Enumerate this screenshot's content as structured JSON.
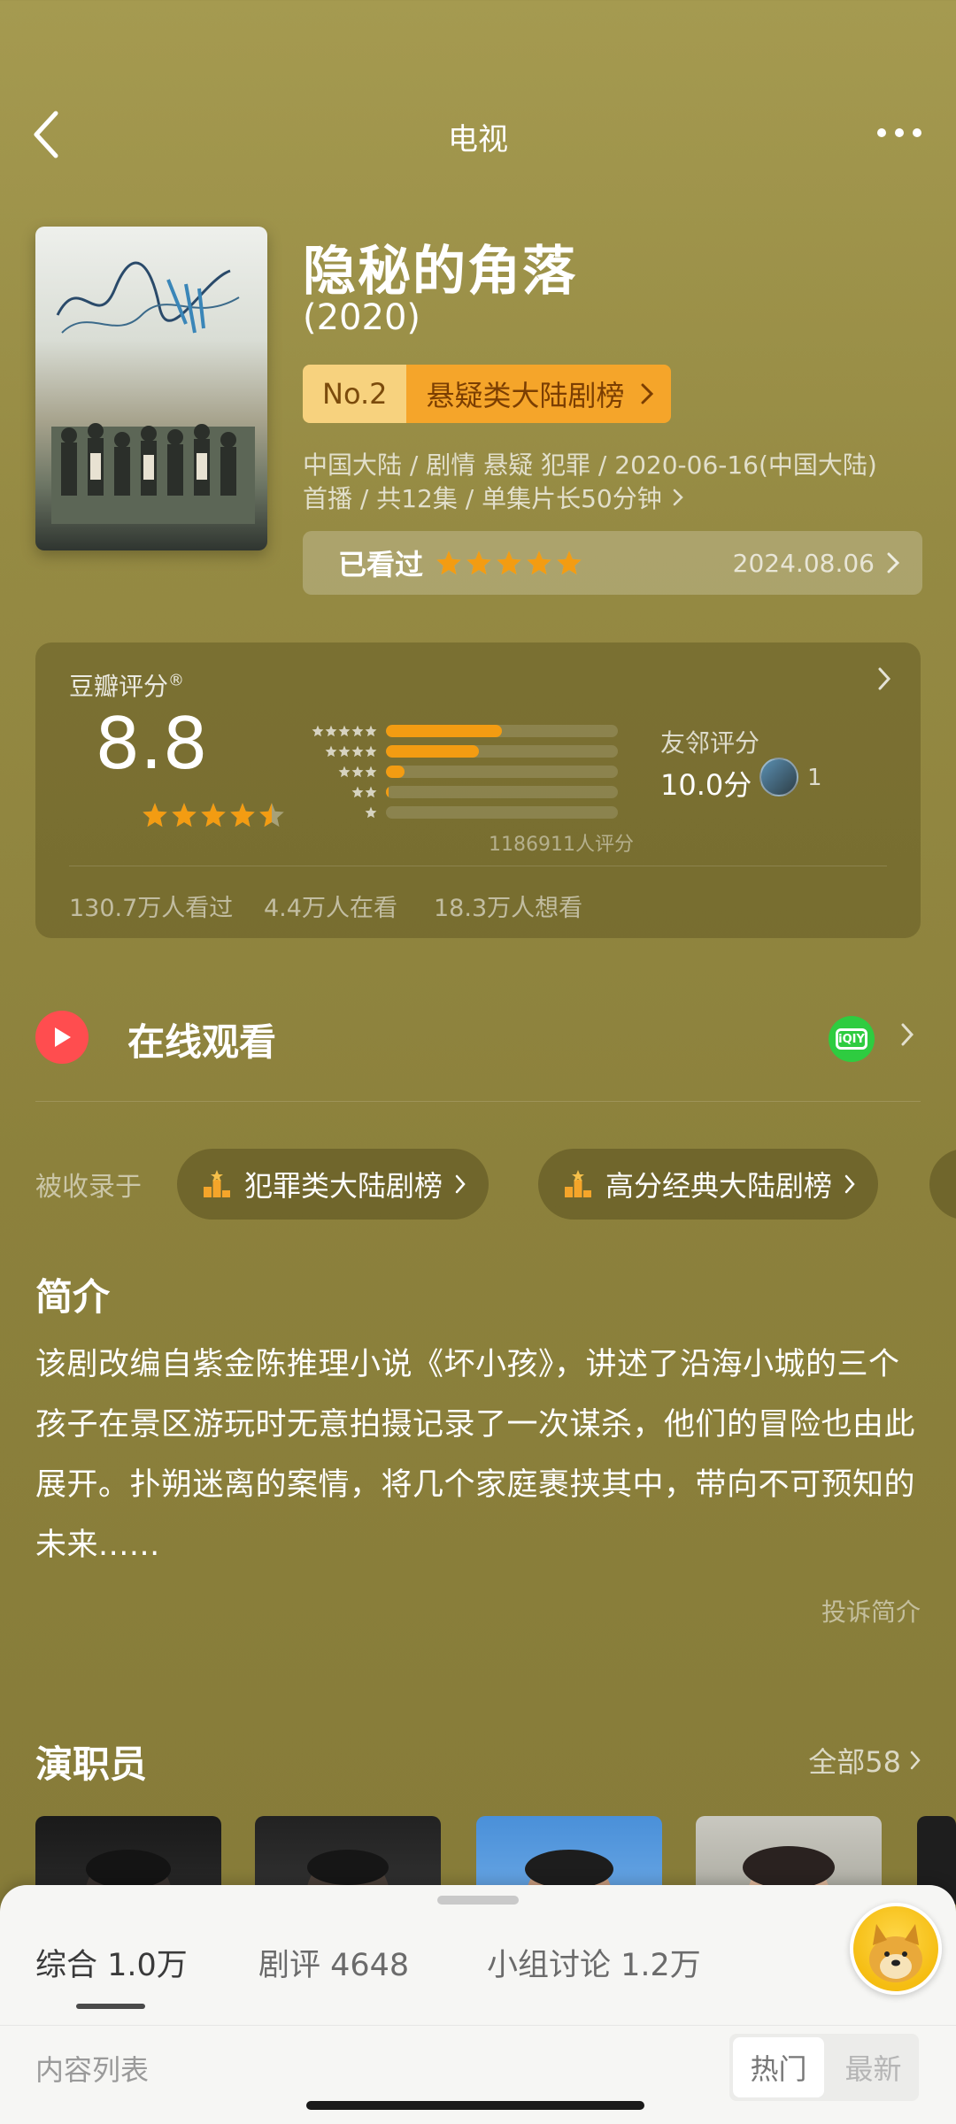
{
  "header": {
    "title": "电视",
    "back_icon": "chevron-left-icon",
    "more_icon": "more-dots-icon"
  },
  "movie": {
    "title": "隐秘的角落",
    "year": "(2020)",
    "rank_no": "No.2",
    "rank_name": "悬疑类大陆剧榜",
    "meta_line1": "中国大陆 / 剧情 悬疑 犯罪 / 2020-06-16(中国大陆)",
    "meta_line2": "首播 / 共12集 / 单集片长50分钟",
    "watched_label": "已看过",
    "watched_stars": 5,
    "watched_date": "2024.08.06"
  },
  "rating": {
    "title": "豆瓣评分",
    "title_mark": "®",
    "score": "8.8",
    "stars": 4.5,
    "distribution": [
      0.5,
      0.4,
      0.08,
      0.01,
      0.0
    ],
    "count": "1186911人评分",
    "friend_label": "友邻评分",
    "friend_score": "10.0分",
    "friend_count": "1",
    "stats": [
      "130.7万人看过",
      "4.4万人在看",
      "18.3万人想看"
    ]
  },
  "online": {
    "title": "在线观看",
    "provider_icon": "iqiyi-icon",
    "provider_text": "iQIY"
  },
  "included": {
    "label": "被收录于",
    "chips": [
      "犯罪类大陆剧榜",
      "高分经典大陆剧榜"
    ]
  },
  "intro": {
    "title": "简介",
    "text": "该剧改编自紫金陈推理小说《坏小孩》，讲述了沿海小城的三个孩子在景区游玩时无意拍摄记录了一次谋杀，他们的冒险也由此展开。扑朔迷离的案情，将几个家庭裹挟其中，带向不可预知的未来......",
    "report": "投诉简介"
  },
  "cast": {
    "title": "演职员",
    "all_label": "全部58"
  },
  "sheet": {
    "tabs": [
      "综合 1.0万",
      "剧评 4648",
      "小组讨论 1.2万"
    ],
    "list_label": "内容列表",
    "sort_hot": "热门",
    "sort_new": "最新"
  },
  "colors": {
    "background": "#958a43",
    "accent_orange": "#f5a52a",
    "star": "#f39c12",
    "play_red": "#ff4d4f",
    "iqiyi_green": "#2ecc40"
  }
}
